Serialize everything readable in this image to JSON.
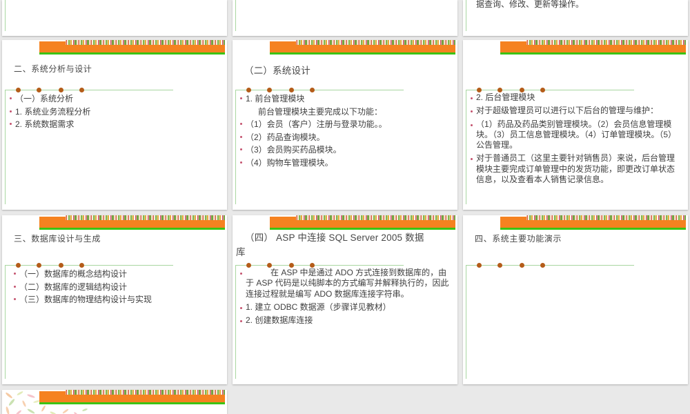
{
  "app": {
    "view_name": "slide-grid-preview"
  },
  "theme": {
    "page_background": "#e9e9e9",
    "slide_background": "#ffffff",
    "banner_orange": "#f58220",
    "banner_green_line": "#3cc314",
    "frame_line_green": "#a8d6a0",
    "frame_dot_orange": "#b45c19",
    "bullet_pink": "#c4526e",
    "title_text": "#474747",
    "body_text": "#3e3e3e",
    "floral_strip_colors": [
      "#d85c43",
      "#f5efdd",
      "#86b54a",
      "#e8aa3e",
      "#c94a5e",
      "#74a43f"
    ]
  },
  "slides": [
    {
      "key": "r1c1",
      "title": "",
      "items": []
    },
    {
      "key": "r1c2",
      "title": "",
      "items": []
    },
    {
      "key": "r1c3",
      "title": "",
      "items": [
        {
          "text": "据查询、修改、更新等操作。",
          "bullet": false
        }
      ]
    },
    {
      "key": "r2c1",
      "title": "二、系统分析与设计",
      "items": [
        {
          "text": "（一）系统分析",
          "bullet": true
        },
        {
          "text": "1. 系统业务流程分析",
          "bullet": true
        },
        {
          "text": "2. 系统数据需求",
          "bullet": true
        }
      ]
    },
    {
      "key": "r2c2",
      "title": "（二）系统设计",
      "items": [
        {
          "text": "1. 前台管理模块",
          "bullet": true
        },
        {
          "text": "前台管理模块主要完成以下功能：",
          "bullet": false,
          "indent": true
        },
        {
          "text": "（1）会员（客户）注册与登录功能。。",
          "bullet": true
        },
        {
          "text": "（2）药品查询模块。",
          "bullet": true
        },
        {
          "text": "（3）会员购买药品模块。",
          "bullet": true
        },
        {
          "text": "（4）购物车管理模块。",
          "bullet": true
        }
      ]
    },
    {
      "key": "r2c3",
      "title": "",
      "items": [
        {
          "text": "2. 后台管理模块",
          "bullet": true
        },
        {
          "text": "对于超级管理员可以进行以下后台的管理与维护：",
          "bullet": true
        },
        {
          "text": "（1）药品及药品类别管理模块。（2）会员信息管理模块。（3）员工信息管理模块。（4）订单管理模块。（5）公告管理。",
          "bullet": true
        },
        {
          "text": "对于普通员工（这里主要针对销售员）来说，后台管理模块主要完成订单管理中的发货功能，即更改订单状态信息，以及查看本人销售记录信息。",
          "bullet": true
        }
      ]
    },
    {
      "key": "r3c1",
      "title": "三、数据库设计与生成",
      "items": [
        {
          "text": "（一）数据库的概念结构设计",
          "bullet": true
        },
        {
          "text": "（二）数据库的逻辑结构设计",
          "bullet": true
        },
        {
          "text": "（三）数据库的物理结构设计与实现",
          "bullet": true
        }
      ]
    },
    {
      "key": "r3c2",
      "title": "（四） ASP 中连接 SQL Server 2005 数据库",
      "items": [
        {
          "text": "在 ASP 中是通过 ADO 方式连接到数据库的，由于 ASP 代码是以纯脚本的方式编写并解释执行的，因此连接过程就是编写 ADO 数据库连接字符串。",
          "bullet": true,
          "first_indent": true
        },
        {
          "text": "1. 建立 ODBC 数据源（步骤详见教材）",
          "bullet": true
        },
        {
          "text": "2. 创建数据库连接",
          "bullet": true
        }
      ]
    },
    {
      "key": "r3c3",
      "title": "四、系统主要功能演示",
      "items": []
    },
    {
      "key": "r4c1",
      "title": "",
      "items": []
    }
  ]
}
